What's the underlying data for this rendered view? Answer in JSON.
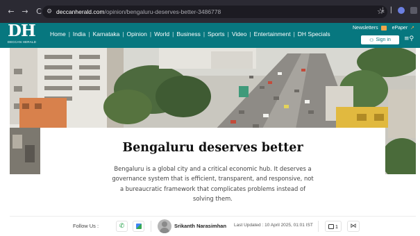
{
  "browser": {
    "url_host": "deccanherald.com",
    "url_path": "/opinion/bengaluru-deserves-better-3486778",
    "back_glyph": "←",
    "forward_glyph": "→",
    "reload_glyph": "C"
  },
  "header": {
    "logo_text": "DH",
    "logo_subtext": "DECCAN HERALD",
    "nav": [
      "Home",
      "India",
      "Karnataka",
      "Opinion",
      "World",
      "Business",
      "Sports",
      "Video",
      "Entertainment",
      "DH Specials"
    ],
    "newsletters_label": "Newsletters",
    "epaper_label": "ePaper",
    "signin_label": "Sign in",
    "background_color": "#07777f"
  },
  "article": {
    "headline": "Bengaluru deserves better",
    "dek": "Bengaluru is a global city and a critical economic hub. It deserves a governance system that is efficient, transparent, and responsive, not a bureaucratic framework that complicates problems instead of solving them.",
    "follow_label": "Follow Us :",
    "author": "Srikanth Narasimhan",
    "last_updated": "Last Updated : 10 April 2025, 01:01 IST",
    "comment_count": "1"
  },
  "icons": {
    "site_info": "site-info-icon",
    "star": "bookmark-star-icon",
    "download": "download-icon",
    "whatsapp": "whatsapp-icon",
    "google_news": "google-news-icon",
    "comment": "comment-icon",
    "share": "share-icon",
    "menu": "menu-search-icon"
  }
}
